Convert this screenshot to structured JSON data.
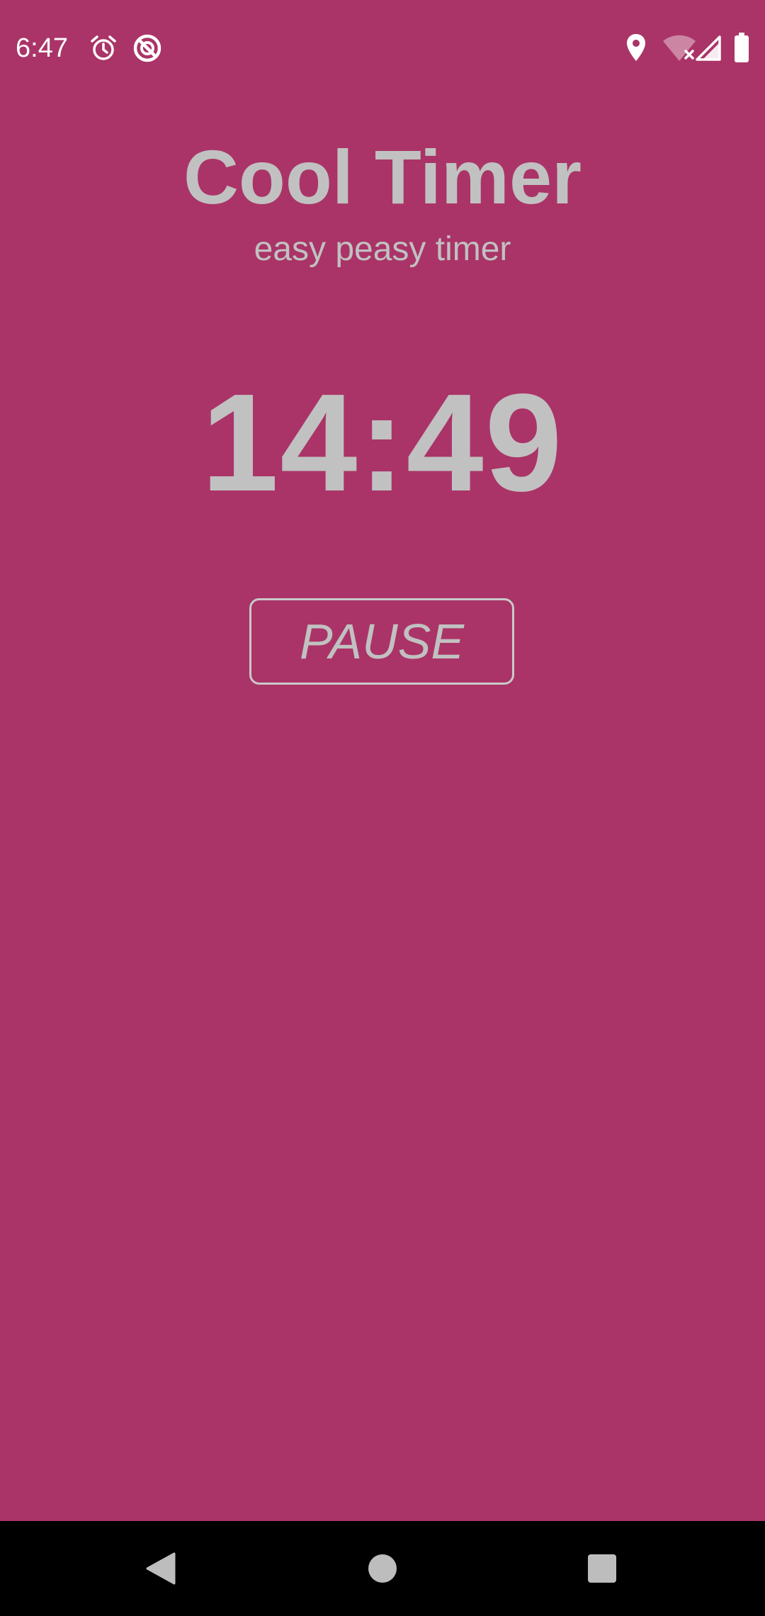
{
  "status_bar": {
    "time": "6:47",
    "icons": [
      "alarm-icon",
      "no-disturb-icon",
      "location-icon",
      "wifi-off-icon",
      "cell-signal-icon",
      "battery-icon"
    ]
  },
  "app": {
    "title": "Cool Timer",
    "subtitle": "easy peasy timer",
    "timer_display": "14:49",
    "pause_label": "PAUSE"
  },
  "nav_bar": {
    "buttons": [
      "back-icon",
      "home-icon",
      "recents-icon"
    ]
  },
  "colors": {
    "background": "#aa3467",
    "text": "#c1c1c1",
    "nav_bar": "#000000"
  }
}
